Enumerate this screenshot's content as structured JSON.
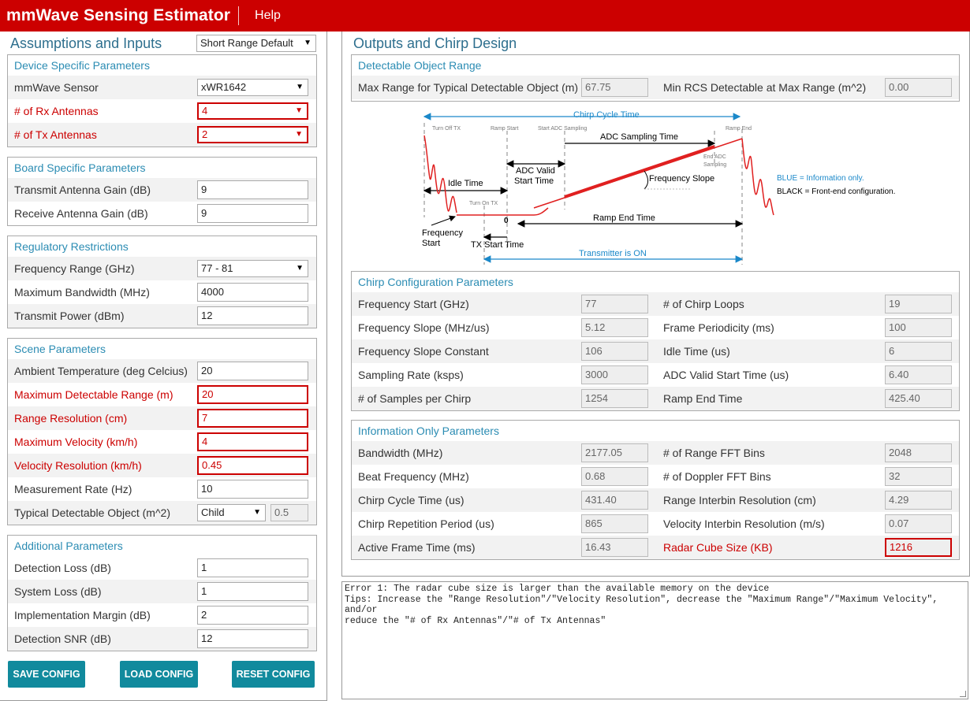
{
  "header": {
    "title": "mmWave Sensing Estimator",
    "help": "Help"
  },
  "left": {
    "title": "Assumptions and Inputs",
    "preset": "Short Range Default",
    "device": {
      "title": "Device Specific Parameters",
      "sensor_label": "mmWave Sensor",
      "sensor_value": "xWR1642",
      "rx_label": "# of Rx Antennas",
      "rx_value": "4",
      "tx_label": "# of Tx Antennas",
      "tx_value": "2"
    },
    "board": {
      "title": "Board Specific Parameters",
      "tx_gain_label": "Transmit Antenna Gain (dB)",
      "tx_gain_value": "9",
      "rx_gain_label": "Receive Antenna Gain (dB)",
      "rx_gain_value": "9"
    },
    "regulatory": {
      "title": "Regulatory Restrictions",
      "freq_label": "Frequency Range (GHz)",
      "freq_value": "77 - 81",
      "bw_label": "Maximum Bandwidth (MHz)",
      "bw_value": "4000",
      "power_label": "Transmit Power (dBm)",
      "power_value": "12"
    },
    "scene": {
      "title": "Scene Parameters",
      "temp_label": "Ambient Temperature (deg Celcius)",
      "temp_value": "20",
      "range_label": "Maximum Detectable Range (m)",
      "range_value": "20",
      "res_label": "Range Resolution (cm)",
      "res_value": "7",
      "vel_label": "Maximum Velocity (km/h)",
      "vel_value": "4",
      "velres_label": "Velocity Resolution (km/h)",
      "velres_value": "0.45",
      "rate_label": "Measurement Rate (Hz)",
      "rate_value": "10",
      "obj_label": "Typical Detectable Object (m^2)",
      "obj_value": "Child",
      "obj_rcs": "0.5"
    },
    "additional": {
      "title": "Additional Parameters",
      "det_loss_label": "Detection Loss (dB)",
      "det_loss_value": "1",
      "sys_loss_label": "System Loss (dB)",
      "sys_loss_value": "1",
      "impl_label": "Implementation Margin (dB)",
      "impl_value": "2",
      "snr_label": "Detection SNR (dB)",
      "snr_value": "12"
    },
    "buttons": {
      "save": "SAVE CONFIG",
      "load": "LOAD CONFIG",
      "reset": "RESET CONFIG"
    }
  },
  "right": {
    "title": "Outputs and Chirp Design",
    "range": {
      "title": "Detectable Object Range",
      "max_label": "Max Range for Typical Detectable Object (m)",
      "max_value": "67.75",
      "rcs_label": "Min RCS Detectable at Max Range (m^2)",
      "rcs_value": "0.00"
    },
    "diagram": {
      "chirp_cycle": "Chirp Cycle Time",
      "turn_off_tx": "Turn Off TX",
      "ramp_start": "Ramp Start",
      "start_adc": "Start ADC Sampling",
      "ramp_end": "Ramp End",
      "adc_sampling": "ADC Sampling Time",
      "end_adc_1": "End ADC",
      "end_adc_2": "Sampling",
      "adc_valid_1": "ADC Valid",
      "adc_valid_2": "Start Time",
      "idle_time": "Idle Time",
      "freq_slope": "Frequency Slope",
      "turn_on_tx": "Turn On TX",
      "zero": "0",
      "ramp_end_time": "Ramp End Time",
      "freq_start_1": "Frequency",
      "freq_start_2": "Start",
      "tx_start": "TX Start Time",
      "tx_on": "Transmitter is ON",
      "legend_blue": "BLUE = Information only.",
      "legend_black": "BLACK = Front-end configuration."
    },
    "chirp": {
      "title": "Chirp Configuration Parameters",
      "rows": [
        {
          "l1": "Frequency Start (GHz)",
          "v1": "77",
          "l2": "# of Chirp Loops",
          "v2": "19"
        },
        {
          "l1": "Frequency Slope (MHz/us)",
          "v1": "5.12",
          "l2": "Frame Periodicity (ms)",
          "v2": "100"
        },
        {
          "l1": "Frequency Slope Constant",
          "v1": "106",
          "l2": "Idle Time (us)",
          "v2": "6"
        },
        {
          "l1": "Sampling Rate (ksps)",
          "v1": "3000",
          "l2": "ADC Valid Start Time (us)",
          "v2": "6.40"
        },
        {
          "l1": "# of Samples per Chirp",
          "v1": "1254",
          "l2": "Ramp End Time",
          "v2": "425.40"
        }
      ]
    },
    "info": {
      "title": "Information Only Parameters",
      "rows": [
        {
          "l1": "Bandwidth (MHz)",
          "v1": "2177.05",
          "l2": "# of Range FFT Bins",
          "v2": "2048"
        },
        {
          "l1": "Beat Frequency (MHz)",
          "v1": "0.68",
          "l2": "# of Doppler FFT Bins",
          "v2": "32"
        },
        {
          "l1": "Chirp Cycle Time (us)",
          "v1": "431.40",
          "l2": "Range Interbin Resolution (cm)",
          "v2": "4.29"
        },
        {
          "l1": "Chirp Repetition Period (us)",
          "v1": "865",
          "l2": "Velocity Interbin Resolution (m/s)",
          "v2": "0.07"
        },
        {
          "l1": "Active Frame Time (ms)",
          "v1": "16.43",
          "l2": "Radar Cube Size (KB)",
          "v2": "1216"
        }
      ]
    }
  },
  "errors": {
    "line1": "Error 1: The radar cube size is larger than the available memory on the device",
    "line2": "Tips: Increase the \"Range Resolution\"/\"Velocity Resolution\", decrease the \"Maximum Range\"/\"Maximum Velocity\", and/or",
    "line3": "reduce the \"# of Rx Antennas\"/\"# of Tx Antennas\""
  }
}
